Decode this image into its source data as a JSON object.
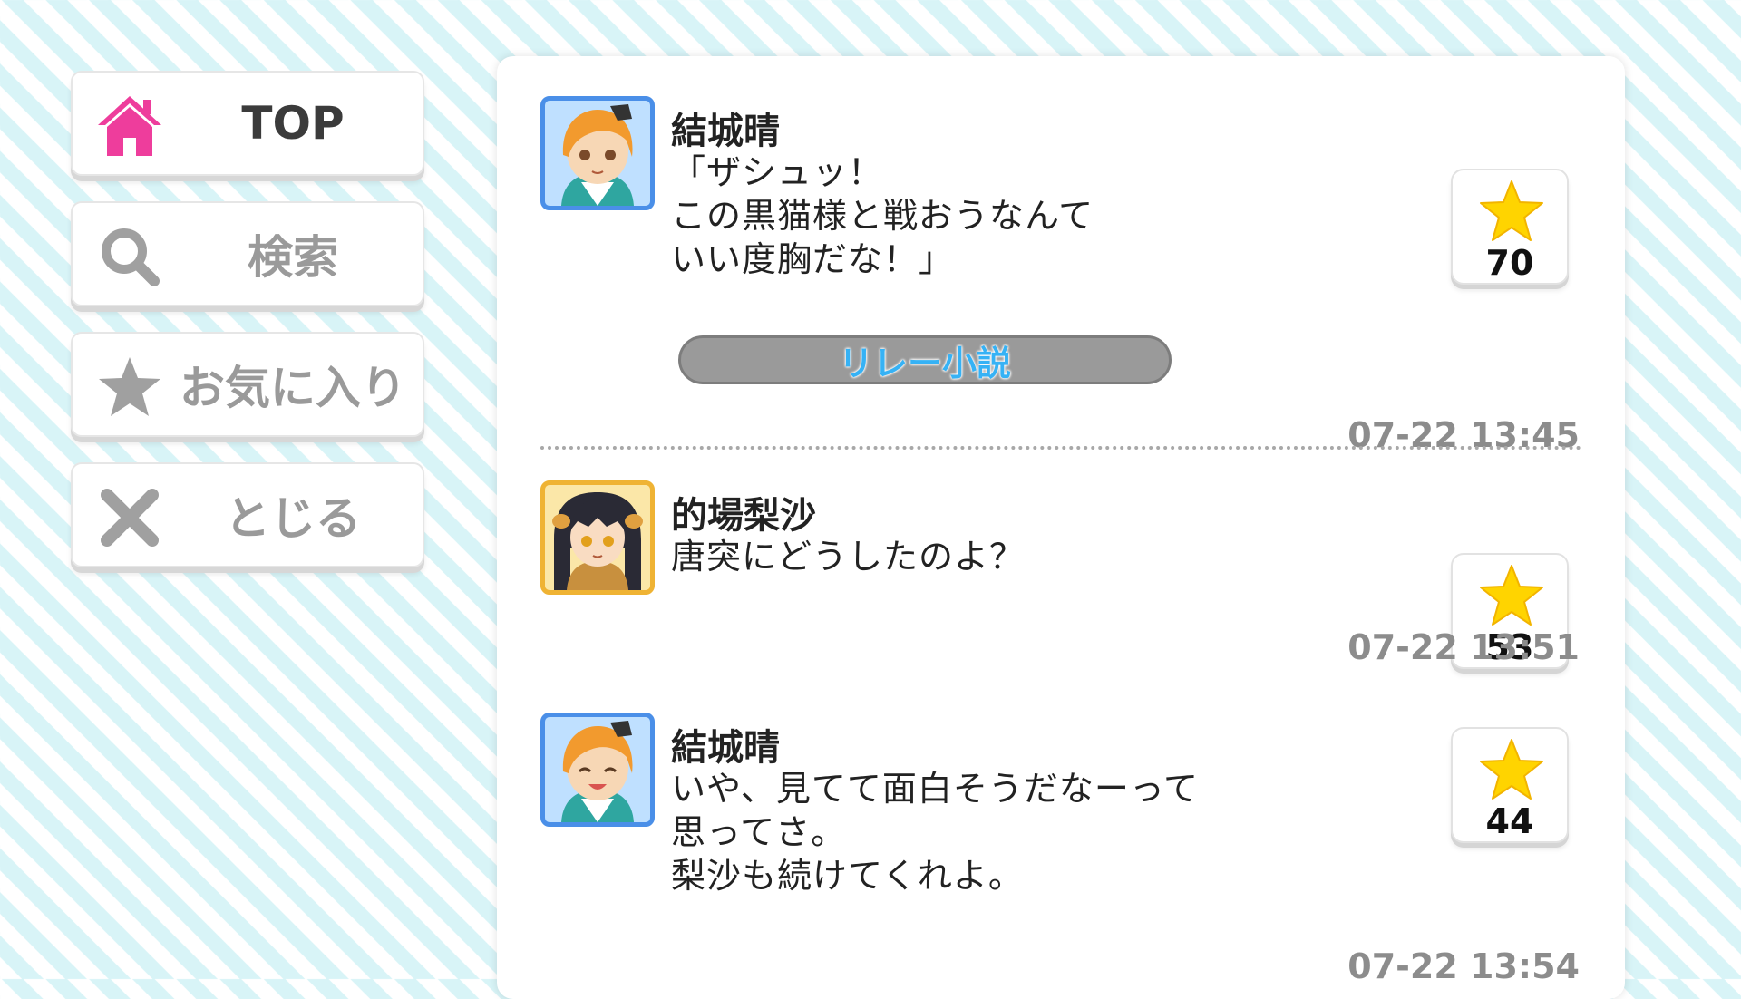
{
  "sidebar": {
    "items": [
      {
        "label": "TOP",
        "icon": "home-icon",
        "color": "#ee3d9c"
      },
      {
        "label": "検索",
        "icon": "search-icon",
        "color": "#a0a0a0"
      },
      {
        "label": "お気に入り",
        "icon": "star-icon",
        "color": "#a0a0a0"
      },
      {
        "label": "とじる",
        "icon": "close-icon",
        "color": "#a0a0a0"
      }
    ]
  },
  "thread": {
    "messages": [
      {
        "name": "結城晴",
        "text": "「ザシュッ！\nこの黒猫様と戦おうなんて\nいい度胸だな！」",
        "tag": "リレー小説",
        "likes": "70",
        "time": "07-22 13:45"
      },
      {
        "name": "的場梨沙",
        "text": "唐突にどうしたのよ？",
        "likes": "53",
        "time": "07-22 13:51"
      },
      {
        "name": "結城晴",
        "text": "いや、見てて面白そうだなーって\n思ってさ。\n梨沙も続けてくれよ。",
        "likes": "44",
        "time": "07-22 13:54"
      }
    ]
  }
}
